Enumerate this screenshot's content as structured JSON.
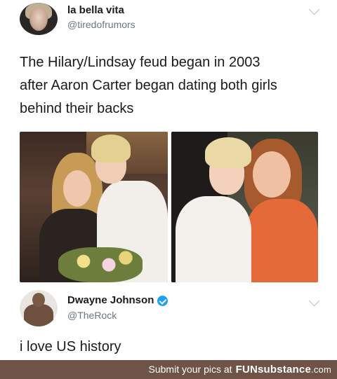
{
  "tweet1": {
    "display_name": "la bella vita",
    "handle": "@tiredofrumors",
    "text_lines": [
      "The Hilary/Lindsay feud began in 2003",
      "after Aaron Carter began dating both girls",
      "behind their backs"
    ]
  },
  "tweet2": {
    "display_name": "Dwayne Johnson",
    "handle": "@TheRock",
    "text": "i love US history"
  },
  "banner": {
    "text": "Submit your pics at",
    "brand_main": "FUNsubstance",
    "brand_suffix": ".com",
    "color": "#6f5346"
  },
  "icons": [
    "chevron-down-icon",
    "verified-badge-icon"
  ],
  "colors": {
    "handle_gray": "#6b7680",
    "verified_blue": "#1da1f2"
  }
}
